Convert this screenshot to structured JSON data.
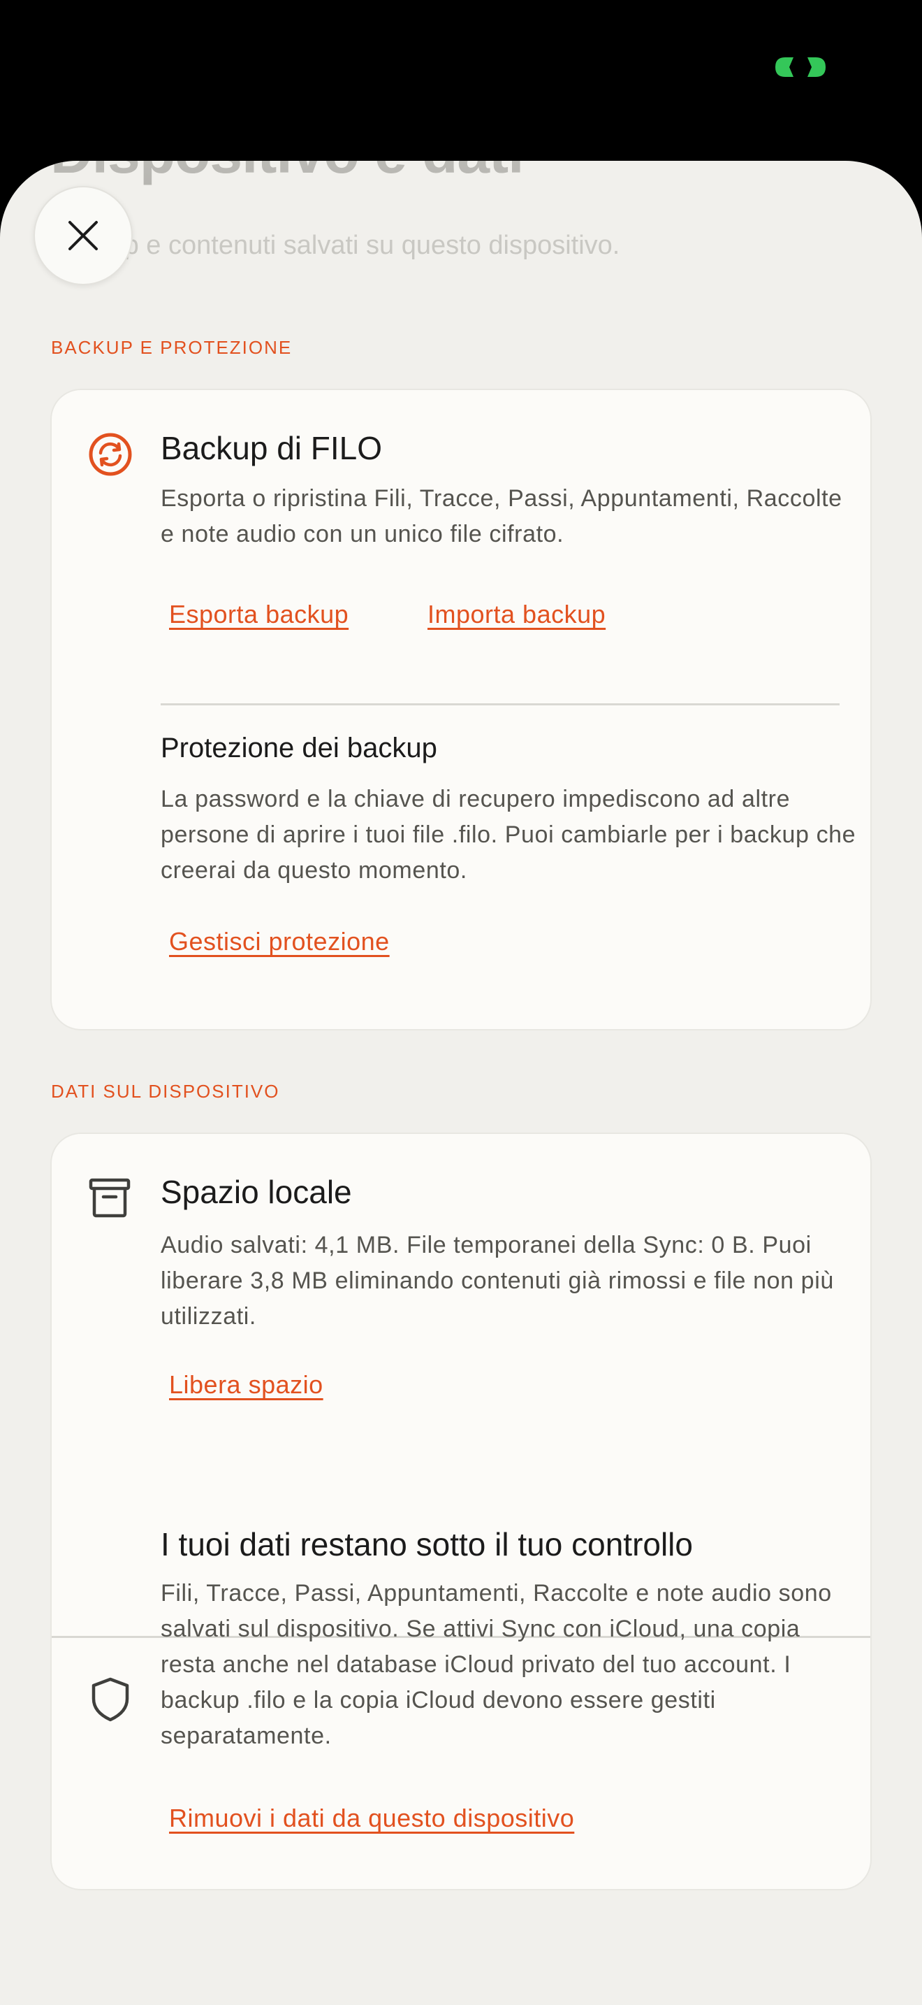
{
  "header": {
    "title": "Dispositivo e dati",
    "subtitle": "Backup e contenuti salvati su questo dispositivo."
  },
  "sections": {
    "backup": {
      "label": "BACKUP E PROTEZIONE",
      "backup_item": {
        "icon": "sync-icon",
        "title": "Backup di FILO",
        "description": "Esporta o ripristina Fili, Tracce, Passi, Appuntamenti, Raccolte e note audio con un unico file cifrato.",
        "export_label": "Esporta backup",
        "import_label": "Importa backup"
      },
      "protection_item": {
        "title": "Protezione dei backup",
        "description": "La password e la chiave di recupero impediscono ad altre persone di aprire i tuoi file .filo. Puoi cambiarle per i backup che creerai da questo momento.",
        "manage_label": "Gestisci protezione"
      }
    },
    "device_data": {
      "label": "DATI SUL DISPOSITIVO",
      "storage_item": {
        "icon": "archive-icon",
        "title": "Spazio locale",
        "description": "Audio salvati: 4,1 MB. File temporanei della Sync: 0 B. Puoi liberare 3,8 MB eliminando contenuti già rimossi e file non più utilizzati.",
        "free_label": "Libera spazio"
      },
      "privacy_item": {
        "icon": "shield-icon",
        "title": "I tuoi dati restano sotto il tuo controllo",
        "description": "Fili, Tracce, Passi, Appuntamenti, Raccolte e note audio sono salvati sul dispositivo. Se attivi Sync con iCloud, una copia resta anche nel database iCloud privato del tuo account. I backup .filo e la copia iCloud devono essere gestiti separatamente.",
        "remove_label": "Rimuovi i dati da questo dispositivo"
      }
    }
  },
  "colors": {
    "accent": "#e2511f",
    "sheet_background": "#f1f0ec",
    "card_background": "#fcfbf8",
    "status_indicator": "#34c759"
  }
}
